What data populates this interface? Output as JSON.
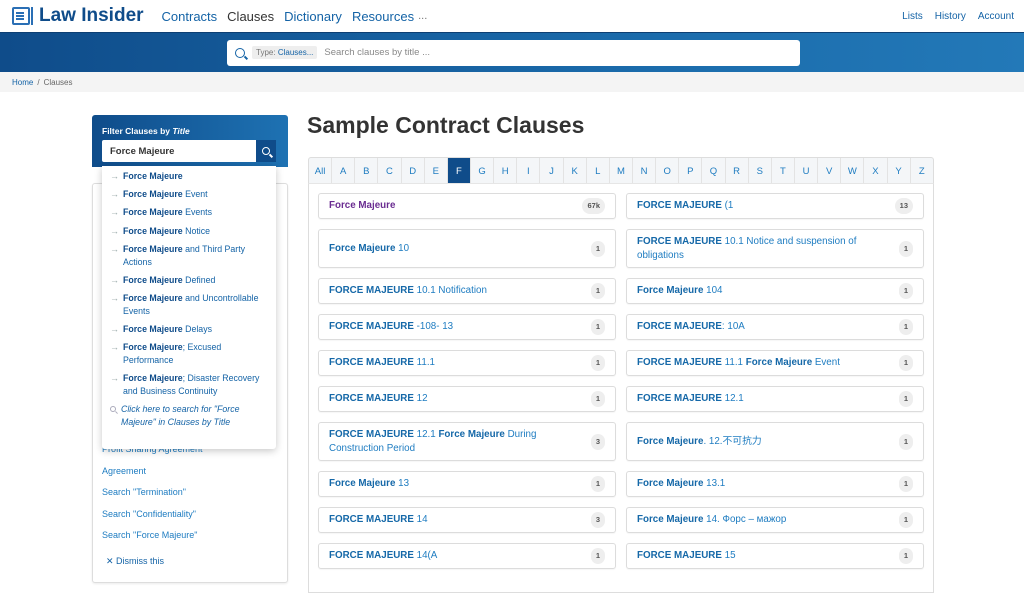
{
  "header": {
    "brand": "Law Insider",
    "nav": [
      "Contracts",
      "Clauses",
      "Dictionary",
      "Resources"
    ],
    "active_nav": "Clauses",
    "more": "...",
    "right_links": [
      "Lists",
      "History",
      "Account"
    ]
  },
  "search": {
    "type_label": "Type:",
    "type_value": "Clauses...",
    "placeholder": "Search clauses by title ..."
  },
  "breadcrumb": {
    "home": "Home",
    "separator": "/",
    "current": "Clauses"
  },
  "filter": {
    "title": "Filter Clauses by ",
    "title_em": "Title",
    "value": "Force Majeure"
  },
  "suggestions": [
    {
      "bold": "Force Majeure",
      "rest": ""
    },
    {
      "bold": "Force Majeure",
      "rest": " Event"
    },
    {
      "bold": "Force Majeure",
      "rest": " Events"
    },
    {
      "bold": "Force Majeure",
      "rest": " Notice"
    },
    {
      "bold": "Force Majeure",
      "rest": " and Third Party Actions"
    },
    {
      "bold": "Force Majeure",
      "rest": " Defined"
    },
    {
      "bold": "Force Majeure",
      "rest": " and Uncontrollable Events"
    },
    {
      "bold": "Force Majeure",
      "rest": " Delays"
    },
    {
      "bold": "Force Majeure",
      "rest": "; Excused Performance"
    },
    {
      "bold": "Force Majeure",
      "rest": "; Disaster Recovery and Business Continuity"
    }
  ],
  "suggestion_search": "Click here to search for \"Force Majeure\" in Clauses by Title",
  "side_links": [
    "Profit Sharing Agreement",
    "Agreement",
    "Search \"Termination\"",
    "Search \"Confidentiality\"",
    "Search \"Force Majeure\""
  ],
  "dismiss": "Dismiss this",
  "main": {
    "title": "Sample Contract Clauses",
    "letters": [
      "All",
      "A",
      "B",
      "C",
      "D",
      "E",
      "F",
      "G",
      "H",
      "I",
      "J",
      "K",
      "L",
      "M",
      "N",
      "O",
      "P",
      "Q",
      "R",
      "S",
      "T",
      "U",
      "V",
      "W",
      "X",
      "Y",
      "Z"
    ],
    "active_letter": "F",
    "clauses": [
      [
        {
          "bold": "Force Majeure",
          "rest": "",
          "count": "67k",
          "visited": true
        },
        {
          "bold": "FORCE MAJEURE",
          "rest": " (1",
          "count": "13"
        }
      ],
      [
        {
          "bold": "Force Majeure",
          "rest": " 10",
          "count": "1",
          "tall": true
        },
        {
          "bold": "FORCE MAJEURE",
          "rest": " 10.1 Notice and suspension of obligations",
          "count": "1",
          "tall": true
        }
      ],
      [
        {
          "bold": "FORCE MAJEURE",
          "rest": " 10.1 Notification",
          "count": "1"
        },
        {
          "bold": "Force Majeure",
          "rest": " 104",
          "count": "1"
        }
      ],
      [
        {
          "bold": "FORCE MAJEURE",
          "rest": " -108- 13",
          "count": "1"
        },
        {
          "bold": "FORCE MAJEURE",
          "rest": ": 10A",
          "count": "1"
        }
      ],
      [
        {
          "bold": "FORCE MAJEURE",
          "rest": " 11.1",
          "count": "1"
        },
        {
          "bold": "FORCE MAJEURE",
          "rest": " 11.1 ",
          "bold2": "Force Majeure",
          "rest2": " Event",
          "count": "1"
        }
      ],
      [
        {
          "bold": "FORCE MAJEURE",
          "rest": " 12",
          "count": "1"
        },
        {
          "bold": "FORCE MAJEURE",
          "rest": " 12.1",
          "count": "1"
        }
      ],
      [
        {
          "bold": "FORCE MAJEURE",
          "rest": " 12.1 ",
          "bold2": "Force Majeure",
          "rest2": " During Construction Period",
          "count": "3",
          "tall": true
        },
        {
          "bold": "Force Majeure",
          "rest": ". 12.不可抗力",
          "count": "1",
          "tall": true
        }
      ],
      [
        {
          "bold": "Force Majeure",
          "rest": " 13",
          "count": "1"
        },
        {
          "bold": "Force Majeure",
          "rest": " 13.1",
          "count": "1"
        }
      ],
      [
        {
          "bold": "FORCE MAJEURE",
          "rest": " 14",
          "count": "3"
        },
        {
          "bold": "Force Majeure",
          "rest": " 14. Форс – мажор",
          "count": "1"
        }
      ],
      [
        {
          "bold": "FORCE MAJEURE",
          "rest": " 14(A",
          "count": "1"
        },
        {
          "bold": "FORCE MAJEURE",
          "rest": " 15",
          "count": "1"
        }
      ]
    ]
  }
}
